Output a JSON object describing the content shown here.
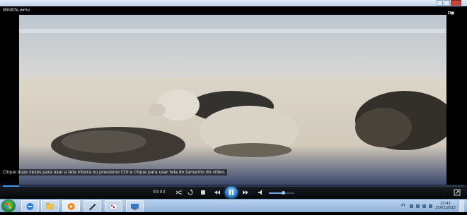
{
  "window": {
    "title": "",
    "header_title": "Wildlife.wmv"
  },
  "video": {
    "hint": "Clique duas vezes para usar a tela inteira ou pressione Ctrl e clique para usar tela do tamanho do vídeo."
  },
  "controls": {
    "elapsed": "00:03",
    "seek_progress_fraction": 0.036,
    "volume_fraction": 0.55,
    "accent_color": "#3f8ee0"
  },
  "icons": {
    "shuffle": "shuffle-icon",
    "repeat": "repeat-icon",
    "stop": "stop-icon",
    "previous": "previous-icon",
    "pause": "pause-icon",
    "next": "next-icon",
    "mute": "speaker-icon",
    "switch_to_library": "switch-to-library-icon",
    "fullscreen": "fullscreen-icon"
  },
  "taskbar": {
    "language": "PT",
    "clock_time": "23:42",
    "clock_date": "25/01/2015",
    "apps": [
      "internet-explorer",
      "file-explorer",
      "media-player",
      "pen-app",
      "paint-app",
      "remote-desktop"
    ]
  }
}
